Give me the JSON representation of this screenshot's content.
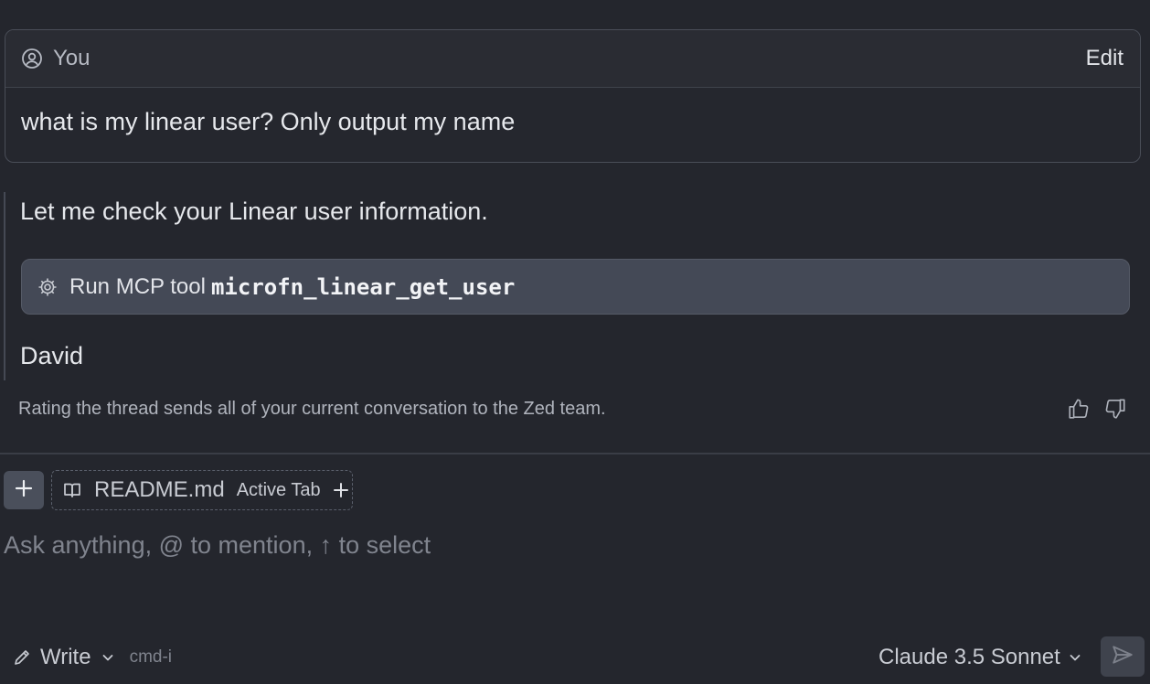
{
  "user_message": {
    "author": "You",
    "edit_label": "Edit",
    "text": "what is my linear user? Only output my name"
  },
  "assistant": {
    "intro": "Let me check your Linear user information.",
    "tool_call": {
      "label": "Run MCP tool",
      "tool_name": "microfn_linear_get_user"
    },
    "answer": "David"
  },
  "rating": {
    "note": "Rating the thread sends all of your current conversation to the Zed team."
  },
  "composer": {
    "context_chip": {
      "filename": "README.md",
      "tag": "Active Tab"
    },
    "placeholder": "Ask anything, @ to mention, ↑ to select",
    "value": "",
    "mode": {
      "label": "Write",
      "shortcut": "cmd-i"
    },
    "model": {
      "label": "Claude 3.5 Sonnet"
    }
  },
  "icons": {
    "user": "user-circle-icon",
    "tool": "gear-icon",
    "thumbs_up": "thumbs-up-icon",
    "thumbs_down": "thumbs-down-icon",
    "add": "plus-icon",
    "file": "book-icon",
    "mode": "pencil-icon",
    "chevron": "chevron-down-icon",
    "send": "send-icon"
  },
  "colors": {
    "background": "#24262d",
    "card_header": "#2a2c33",
    "tool_card": "#444956",
    "text_primary": "#e6e8ec",
    "text_muted": "#80848e"
  }
}
